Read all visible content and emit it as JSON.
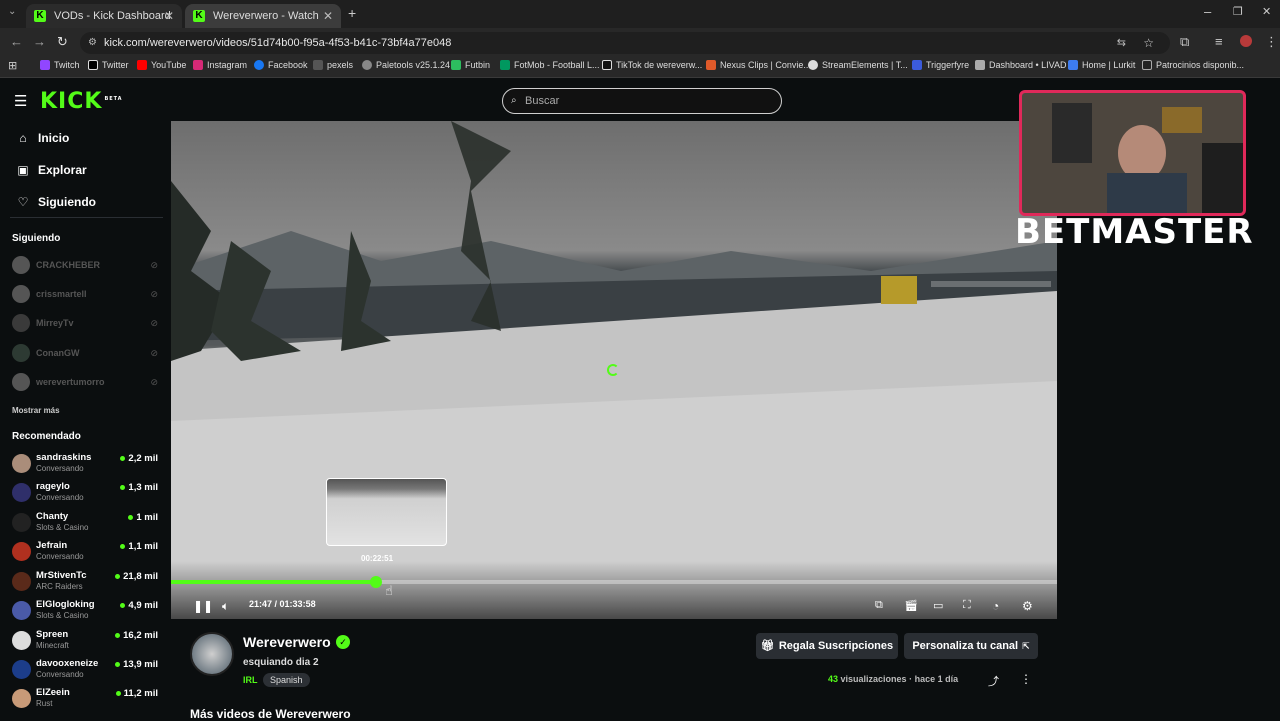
{
  "browser": {
    "tabs": [
      {
        "title": "VODs - Kick Dashboard",
        "active": false
      },
      {
        "title": "Wereverwero - Watch the V",
        "active": true
      }
    ],
    "url": "kick.com/wereverwero/videos/51d74b00-f95a-4f53-b41c-73bf4a77e048",
    "bookmarks": [
      "Twitch",
      "Twitter",
      "YouTube",
      "Instagram",
      "Facebook",
      "pexels",
      "Paletools v25.1.24",
      "Futbin",
      "FotMob - Football L...",
      "TikTok de wereverw...",
      "Nexus Clips | Convie...",
      "StreamElements | T...",
      "Triggerfyre",
      "Dashboard • LIVAD",
      "Home | Lurkit",
      "Patrocinios disponib..."
    ]
  },
  "header": {
    "logo": "KICK",
    "logo_badge": "BETA",
    "search_placeholder": "Buscar"
  },
  "sidebar": {
    "nav": [
      {
        "label": "Inicio",
        "icon": "home-icon"
      },
      {
        "label": "Explorar",
        "icon": "explore-icon"
      },
      {
        "label": "Siguiendo",
        "icon": "heart-icon"
      }
    ],
    "following_title": "Siguiendo",
    "following": [
      "CRACKHEBER",
      "crissmartell",
      "MirreyTv",
      "ConanGW",
      "werevertumorro"
    ],
    "show_more": "Mostrar más",
    "recommended_title": "Recomendado",
    "recommended": [
      {
        "name": "sandraskins",
        "category": "Conversando",
        "viewers": "2,2 mil"
      },
      {
        "name": "rageylo",
        "category": "Conversando",
        "viewers": "1,3 mil"
      },
      {
        "name": "Chanty",
        "category": "Slots & Casino",
        "viewers": "1 mil"
      },
      {
        "name": "Jefrain",
        "category": "Conversando",
        "viewers": "1,1 mil"
      },
      {
        "name": "MrStivenTc",
        "category": "ARC Raiders",
        "viewers": "21,8 mil"
      },
      {
        "name": "ElGlogloking",
        "category": "Slots & Casino",
        "viewers": "4,9 mil"
      },
      {
        "name": "Spreen",
        "category": "Minecraft",
        "viewers": "16,2 mil"
      },
      {
        "name": "davooxeneize",
        "category": "Conversando",
        "viewers": "13,9 mil"
      },
      {
        "name": "ElZeein",
        "category": "Rust",
        "viewers": "11,2 mil"
      }
    ]
  },
  "player": {
    "current_time": "21:47",
    "duration": "01:33:58",
    "progress_fraction": 0.2318,
    "preview_time": "00:22:51",
    "accent_color": "#53fc18"
  },
  "overlay": {
    "brand": "BETMASTER"
  },
  "channel": {
    "name": "Wereverwero",
    "video_title": "esquiando dia 2",
    "category": "IRL",
    "language": "Spanish",
    "gift_button": "Regala Suscripciones",
    "customize_button": "Personaliza tu canal",
    "views_count": "43",
    "views_label": "visualizaciones",
    "posted": "hace 1 día",
    "more_videos_title": "Más videos de Wereverwero"
  }
}
